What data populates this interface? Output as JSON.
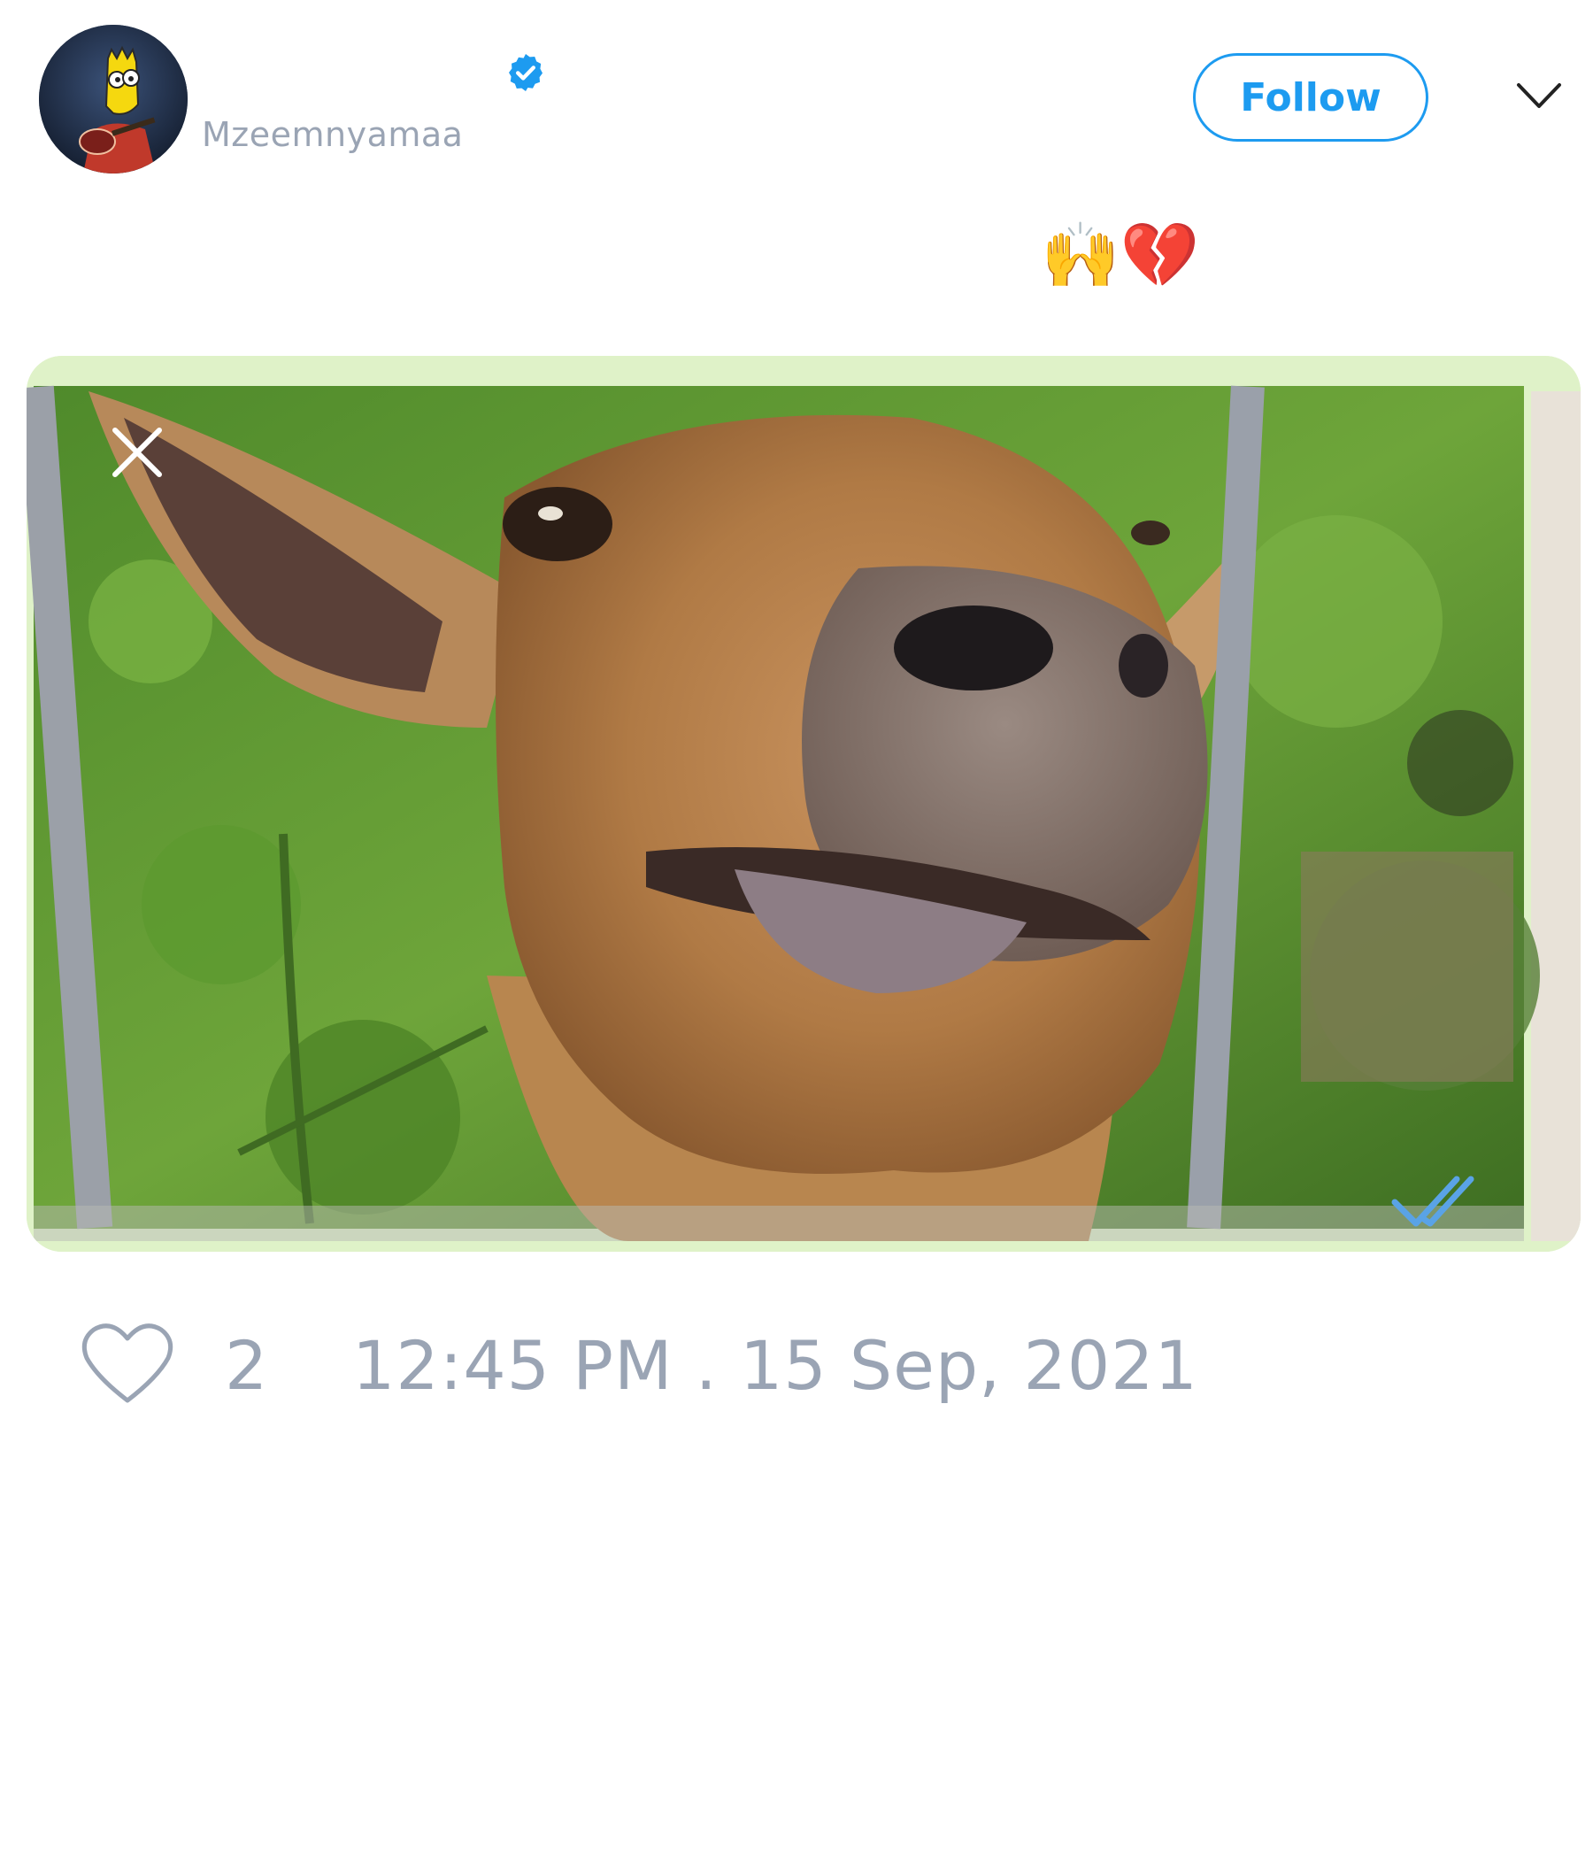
{
  "header": {
    "handle": "Mzeemnyamaa",
    "follow_label": "Follow"
  },
  "tweet": {
    "text": "🙌💔"
  },
  "footer": {
    "like_count": "2",
    "timestamp": "12:45 PM . 15 Sep, 2021"
  },
  "colors": {
    "accent": "#1d9bf0",
    "muted": "#9aa4b4"
  },
  "icons": [
    "verified-badge-icon",
    "chevron-down-icon",
    "heart-icon",
    "close-icon",
    "double-check-icon"
  ]
}
